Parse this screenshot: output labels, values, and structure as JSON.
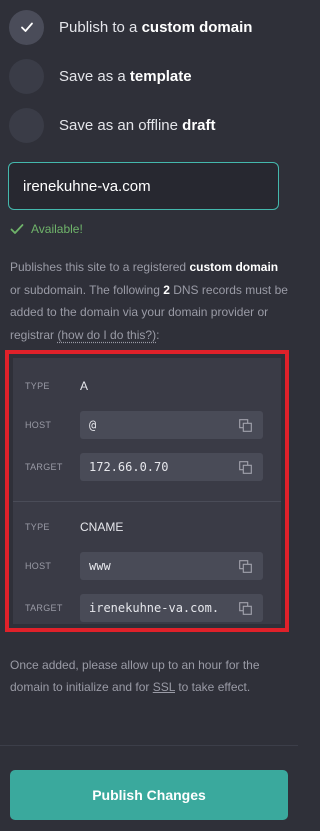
{
  "options": [
    {
      "prefix": "Publish to a ",
      "bold": "custom domain",
      "checked": true
    },
    {
      "prefix": "Save as a ",
      "bold": "template",
      "checked": false
    },
    {
      "prefix": "Save as an offline ",
      "bold": "draft",
      "checked": false
    }
  ],
  "domain_input": {
    "value": "irenekuhne-va.com"
  },
  "availability": {
    "text": "Available!",
    "color": "#6fb36a"
  },
  "description": {
    "p1": "Publishes this site to a registered ",
    "b1": "custom domain",
    "p2": " or subdomain. The following ",
    "b2": "2",
    "p3": " DNS records must be added to the domain via your domain provider or registrar ",
    "link": "(how do I do this?)",
    "p4": ":"
  },
  "dns_records": [
    {
      "type_label": "TYPE",
      "type": "A",
      "host_label": "HOST",
      "host": "@",
      "target_label": "TARGET",
      "target": "172.66.0.70"
    },
    {
      "type_label": "TYPE",
      "type": "CNAME",
      "host_label": "HOST",
      "host": "www",
      "target_label": "TARGET",
      "target": "irenekuhne-va.com."
    }
  ],
  "note": {
    "p1": "Once added, please allow up to an hour for the domain to initialize and for ",
    "u": "SSL",
    "p2": " to take effect."
  },
  "publish_button": {
    "label": "Publish Changes"
  },
  "colors": {
    "accent": "#3aa99d",
    "highlight_border": "#e0212a",
    "background": "#2f3039"
  }
}
